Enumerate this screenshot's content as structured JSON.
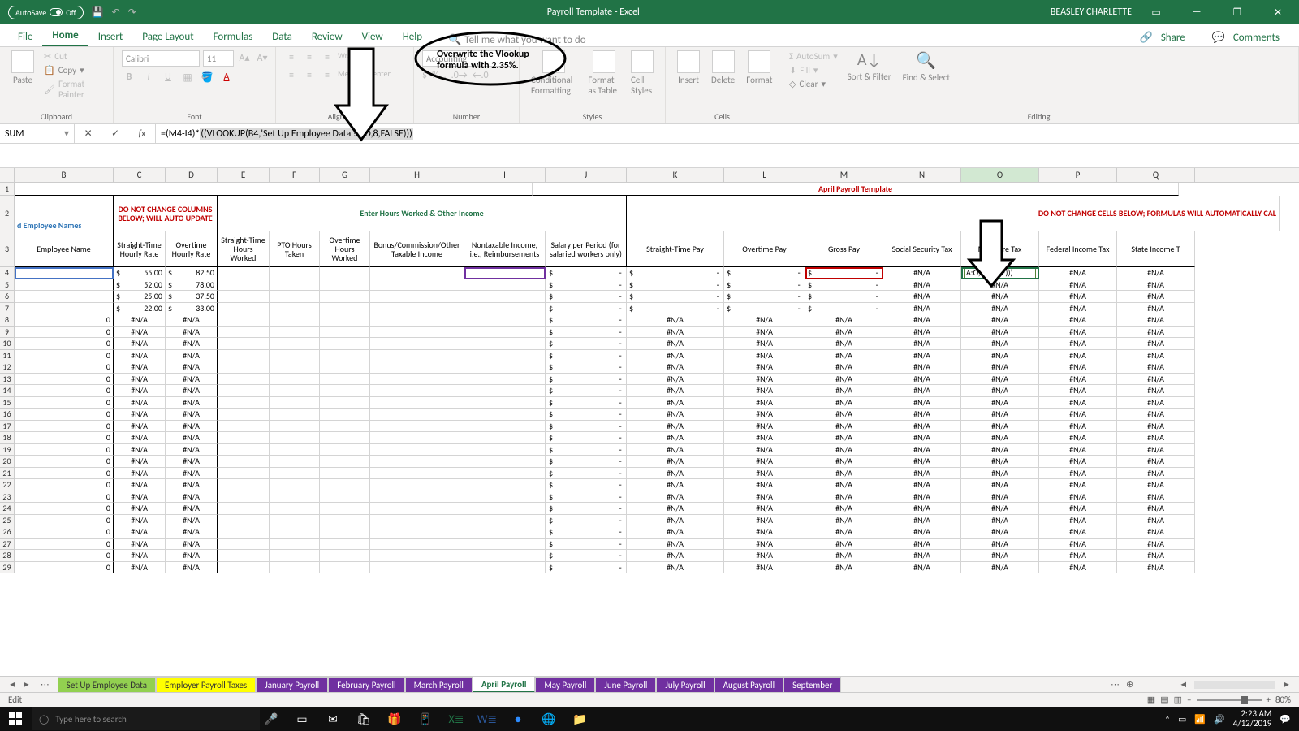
{
  "title_bar": {
    "autosave": "AutoSave",
    "autosave_state": "Off",
    "doc_title": "Payroll Template - Excel",
    "user": "BEASLEY CHARLETTE"
  },
  "tabs": [
    "File",
    "Home",
    "Insert",
    "Page Layout",
    "Formulas",
    "Data",
    "Review",
    "View",
    "Help"
  ],
  "active_tab": "Home",
  "tellme": "Tell me what you want to do",
  "share": "Share",
  "comments": "Comments",
  "ribbon": {
    "clipboard": {
      "label": "Clipboard",
      "paste": "Paste",
      "cut": "Cut",
      "copy": "Copy",
      "format_painter": "Format Painter"
    },
    "font": {
      "label": "Font",
      "name": "Calibri",
      "size": "11"
    },
    "alignment": {
      "label": "Alignment",
      "wrap": "Wrap Text",
      "merge": "Merge & Center"
    },
    "number": {
      "label": "Number",
      "format": "Accounting"
    },
    "styles": {
      "label": "Styles",
      "cond": "Conditional Formatting",
      "fmt_table": "Format as Table",
      "cell_styles": "Cell Styles"
    },
    "cells": {
      "label": "Cells",
      "insert": "Insert",
      "delete": "Delete",
      "format": "Format"
    },
    "editing": {
      "label": "Editing",
      "autosum": "AutoSum",
      "fill": "Fill",
      "clear": "Clear",
      "sort": "Sort & Filter",
      "find": "Find & Select"
    }
  },
  "name_box": "SUM",
  "formula": {
    "p1": "=(M4-I4)*",
    "p2": "((VLOOKUP(B4,'Set Up Employee Data'!A:O,8,FALSE)))"
  },
  "col_letters": [
    "B",
    "C",
    "D",
    "E",
    "F",
    "G",
    "H",
    "I",
    "J",
    "K",
    "L",
    "M",
    "N",
    "O",
    "P",
    "Q"
  ],
  "row1_title": "April Payroll Template",
  "row2": {
    "warn1": "DO NOT CHANGE COLUMNS BELOW; WILL AUTO UPDATE",
    "employee_names": "d Employee Names",
    "enter_hours": "Enter Hours Worked & Other Income",
    "warn2": "DO NOT CHANGE CELLS BELOW; FORMULAS WILL AUTOMATICALLY CAL"
  },
  "headers": [
    "Employee Name",
    "Straight-Time Hourly Rate",
    "Overtime Hourly Rate",
    "Straight-Time Hours Worked",
    "PTO Hours Taken",
    "Overtime Hours Worked",
    "Bonus/Commission/Other Taxable Income",
    "Nontaxable Income, i.e., Reimbursements",
    "Salary per Period (for salaried workers only)",
    "Straight-Time Pay",
    "Overtime Pay",
    "Gross Pay",
    "Social Security Tax",
    "Medicare Tax",
    "Federal Income Tax",
    "State Income T"
  ],
  "rates": [
    {
      "st": "55.00",
      "ot": "82.50"
    },
    {
      "st": "52.00",
      "ot": "78.00"
    },
    {
      "st": "25.00",
      "ot": "37.50"
    },
    {
      "st": "22.00",
      "ot": "33.00"
    }
  ],
  "edit_cell": "A:O,8,FALSE)))",
  "na": "#N/A",
  "dash": "-",
  "zero": "0",
  "dollar": "$",
  "sheet_tabs": [
    "Set Up Employee Data",
    "Employer Payroll Taxes",
    "January Payroll",
    "February Payroll",
    "March Payroll",
    "April Payroll",
    "May Payroll",
    "June Payroll",
    "July Payroll",
    "August Payroll",
    "September"
  ],
  "active_sheet": "April Payroll",
  "status": "Edit",
  "zoom": "80%",
  "taskbar": {
    "search_placeholder": "Type here to search"
  },
  "tray": {
    "time": "2:23 AM",
    "date": "4/12/2019"
  },
  "annotation": {
    "callout": "Overwrite the Vlookup formula with 2.35%."
  }
}
